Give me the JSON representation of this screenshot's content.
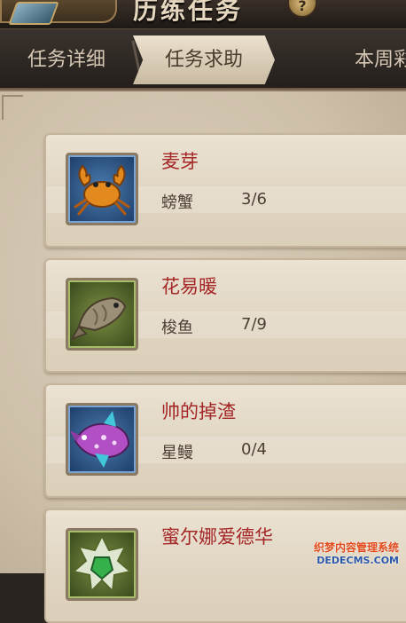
{
  "header": {
    "title": "历练任务",
    "help_glyph": "?"
  },
  "tabs": [
    {
      "label": "任务详细",
      "active": false
    },
    {
      "label": "任务求助",
      "active": true
    },
    {
      "label": "本周彩",
      "active": false
    }
  ],
  "requests": [
    {
      "player": "麦芽",
      "item": "螃蟹",
      "progress": "3/6",
      "icon": "crab-icon",
      "frame": "blue"
    },
    {
      "player": "花易暖",
      "item": "梭鱼",
      "progress": "7/9",
      "icon": "fish-icon",
      "frame": "green"
    },
    {
      "player": "帅的掉渣",
      "item": "星鳗",
      "progress": "0/4",
      "icon": "star-eel-icon",
      "frame": "blue"
    },
    {
      "player": "蜜尔娜爱德华",
      "item": "",
      "progress": "",
      "icon": "gem-icon",
      "frame": "green"
    }
  ],
  "watermark": {
    "line1": "织梦内容管理系统",
    "line2": "DEDECMS.COM"
  },
  "colors": {
    "player_name": "#a42626",
    "active_tab_bg": "#ece1cf",
    "parchment": "#dcd0bd"
  }
}
